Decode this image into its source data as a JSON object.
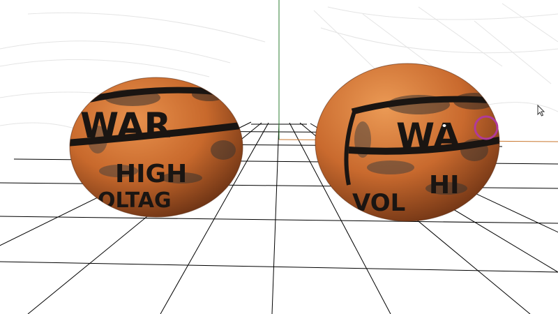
{
  "viewport": {
    "background": "#ffffff",
    "grid_color": "#000000",
    "y_axis_color": "#2e7d32",
    "x_axis_color": "#c9772e",
    "selection_ring_color": "#b03a9a"
  },
  "objects": [
    {
      "name": "sphere-left",
      "material": "rusty-orange-metal",
      "base_color": "#c8692c",
      "labels": {
        "band_text": "WAR",
        "line1": "HIGH",
        "line2": "OLTAG"
      }
    },
    {
      "name": "sphere-right",
      "material": "rusty-orange-metal",
      "base_color": "#c8692c",
      "labels": {
        "band_text": "WA",
        "line1": "HI",
        "line2": "VOL"
      }
    }
  ],
  "cursor": {
    "icon": "arrow-cursor-icon"
  },
  "gizmo": {
    "icon": "selection-ring-icon"
  }
}
